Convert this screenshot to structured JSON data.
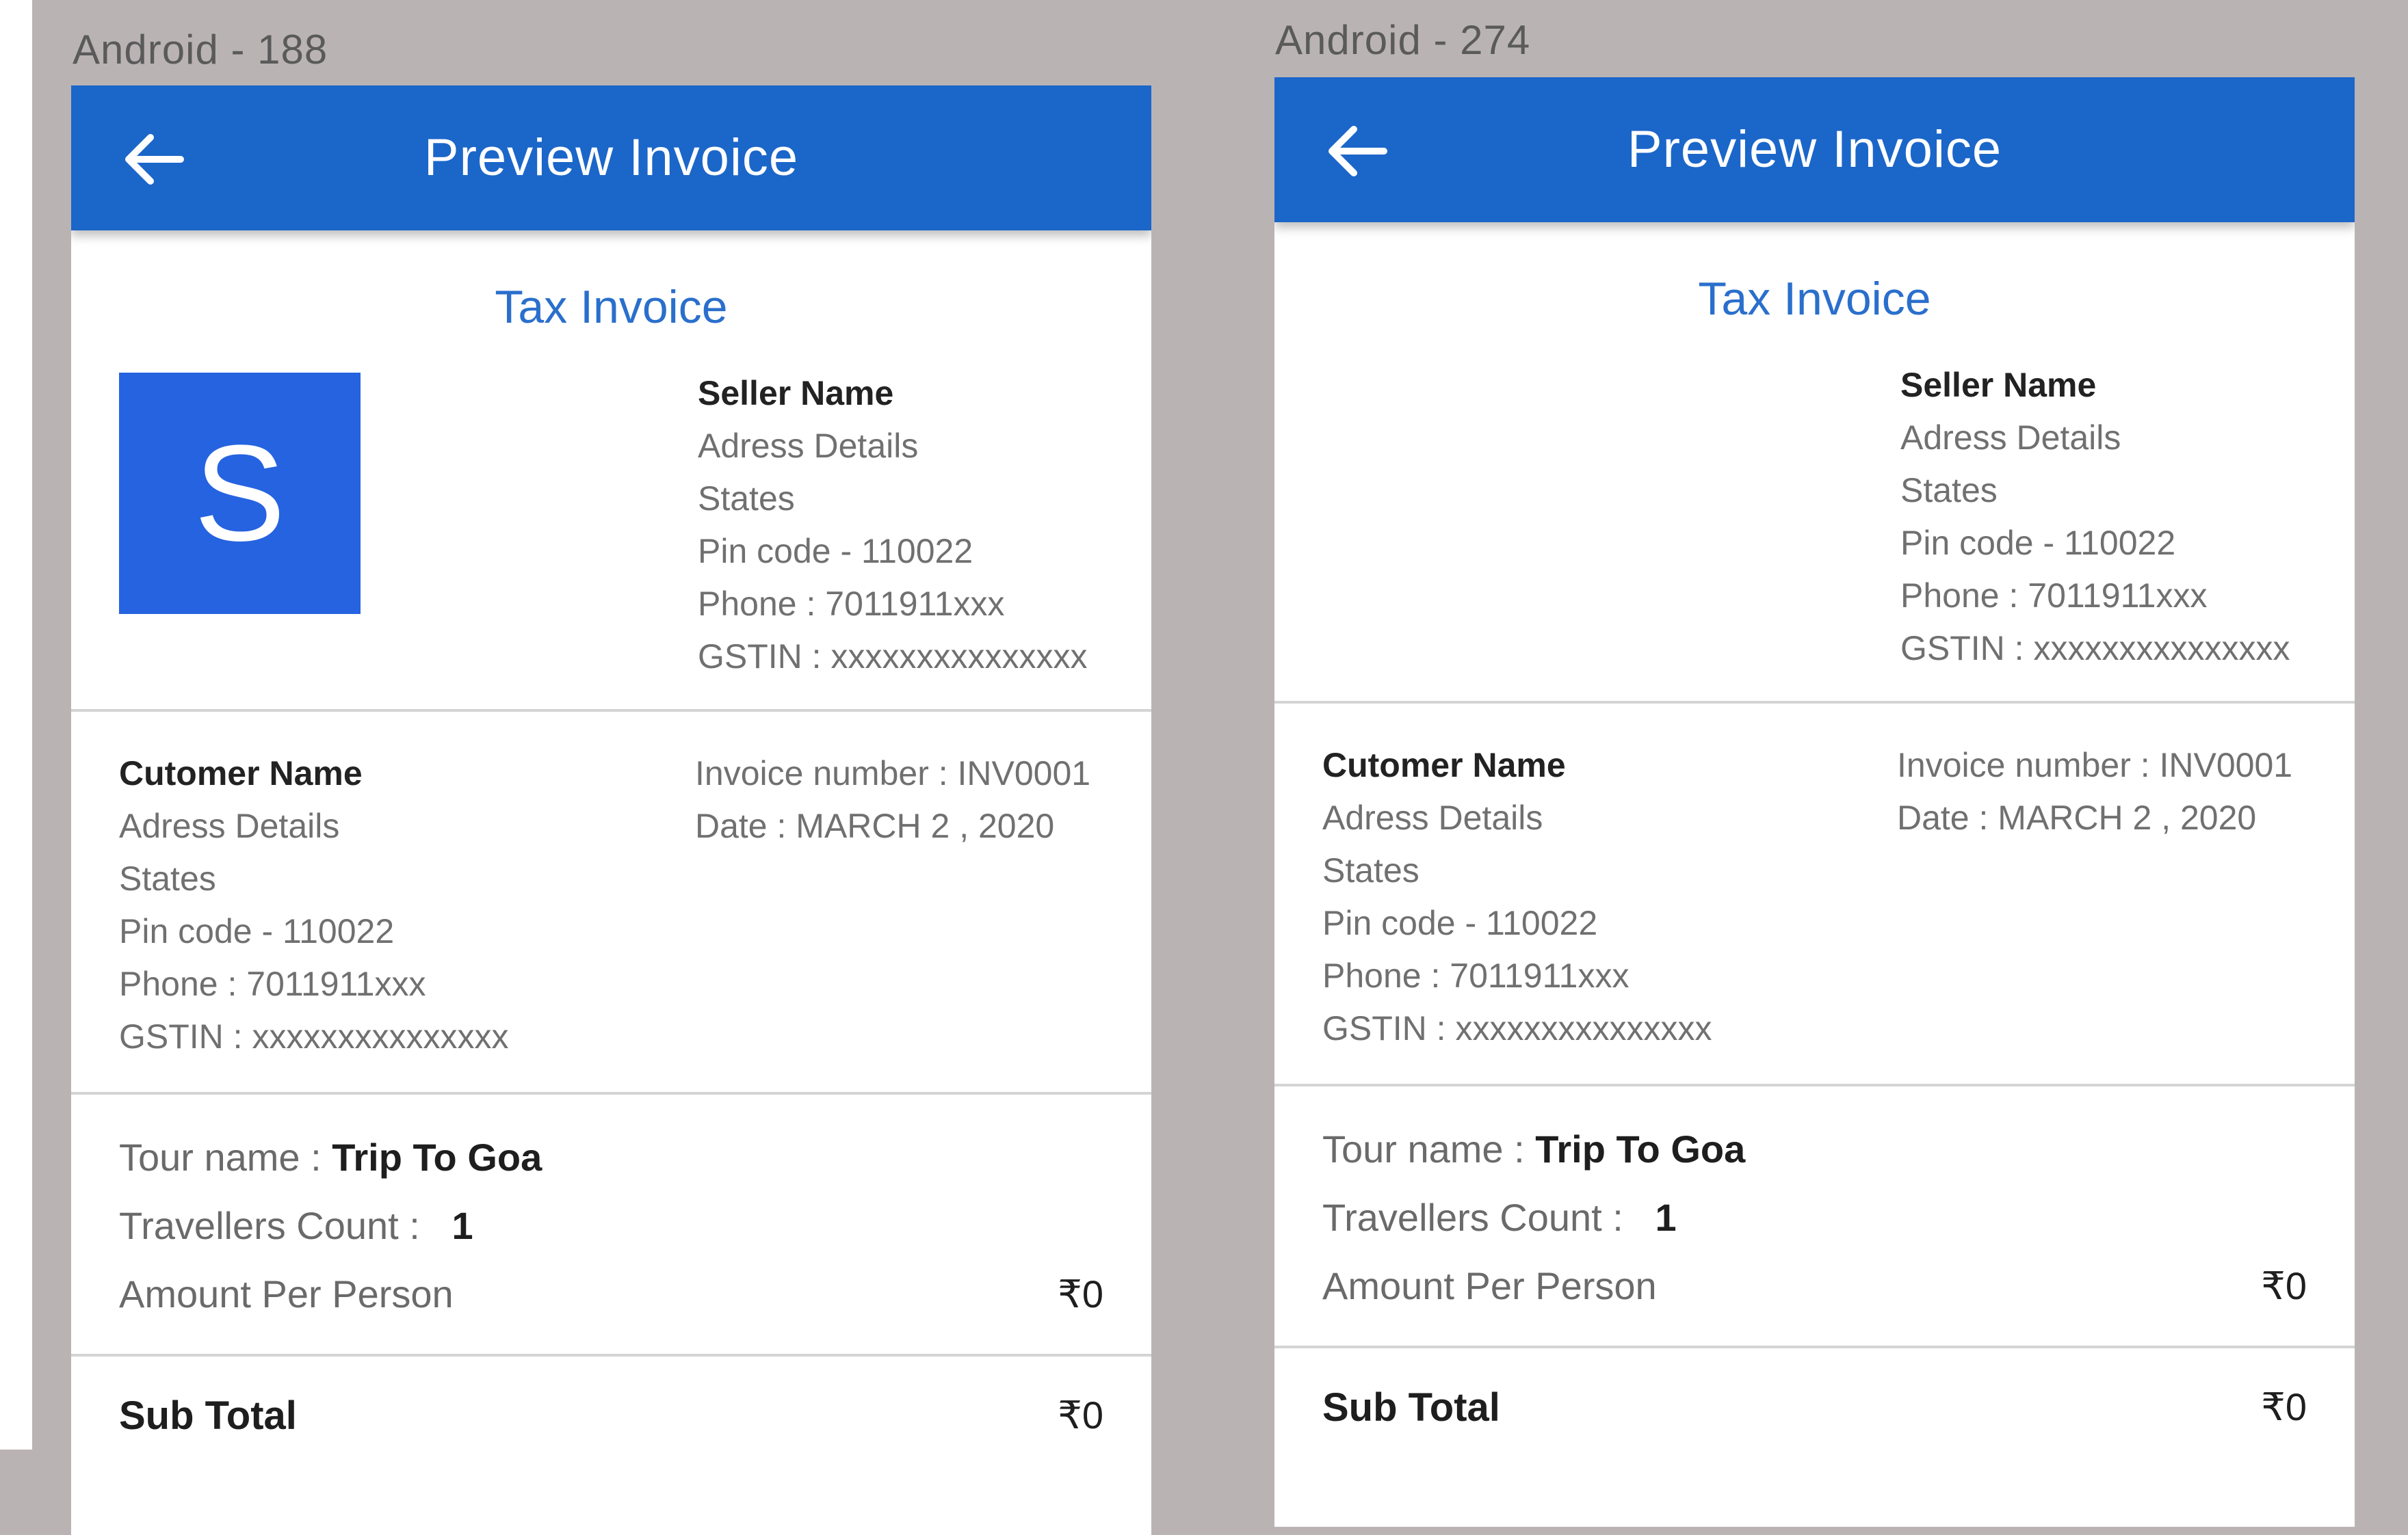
{
  "frames": [
    {
      "label": "Android - 188",
      "appbar": {
        "title": "Preview Invoice",
        "back_icon": "arrow-left-icon"
      },
      "tax_title": "Tax Invoice",
      "logo": {
        "letter": "S",
        "color": "#2563e0"
      },
      "seller": {
        "name": "Seller Name",
        "address": "Adress Details",
        "states": "States",
        "pincode": "Pin code - 110022",
        "phone": "Phone : 7011911xxx",
        "gstin": "GSTIN : xxxxxxxxxxxxxxx"
      },
      "customer": {
        "name": "Cutomer Name",
        "address": "Adress Details",
        "states": "States",
        "pincode": "Pin code - 110022",
        "phone": "Phone : 7011911xxx",
        "gstin": "GSTIN : xxxxxxxxxxxxxxx"
      },
      "invoice": {
        "number": "Invoice number : INV0001",
        "date": "Date : MARCH 2 , 2020"
      },
      "tour": {
        "name_label": "Tour name : ",
        "name_value": "Trip To Goa",
        "travellers_label": "Travellers Count : ",
        "travellers_value": "1",
        "amount_label": "Amount Per Person",
        "amount_value": "₹0"
      },
      "subtotal": {
        "label": "Sub Total",
        "value": "₹0"
      }
    },
    {
      "label": "Android - 274",
      "appbar": {
        "title": "Preview Invoice",
        "back_icon": "arrow-left-icon"
      },
      "tax_title": "Tax Invoice",
      "seller": {
        "name": "Seller Name",
        "address": "Adress Details",
        "states": "States",
        "pincode": "Pin code - 110022",
        "phone": "Phone : 7011911xxx",
        "gstin": "GSTIN : xxxxxxxxxxxxxxx"
      },
      "customer": {
        "name": "Cutomer Name",
        "address": "Adress Details",
        "states": "States",
        "pincode": "Pin code - 110022",
        "phone": "Phone : 7011911xxx",
        "gstin": "GSTIN : xxxxxxxxxxxxxxx"
      },
      "invoice": {
        "number": "Invoice number : INV0001",
        "date": "Date : MARCH 2 , 2020"
      },
      "tour": {
        "name_label": "Tour name : ",
        "name_value": "Trip To Goa",
        "travellers_label": "Travellers Count : ",
        "travellers_value": "1",
        "amount_label": "Amount Per Person",
        "amount_value": "₹0"
      },
      "subtotal": {
        "label": "Sub Total",
        "value": "₹0"
      }
    }
  ],
  "colors": {
    "appbar": "#1b66c9",
    "accent_text": "#2a6fcc",
    "canvas": "#bab3b4"
  }
}
